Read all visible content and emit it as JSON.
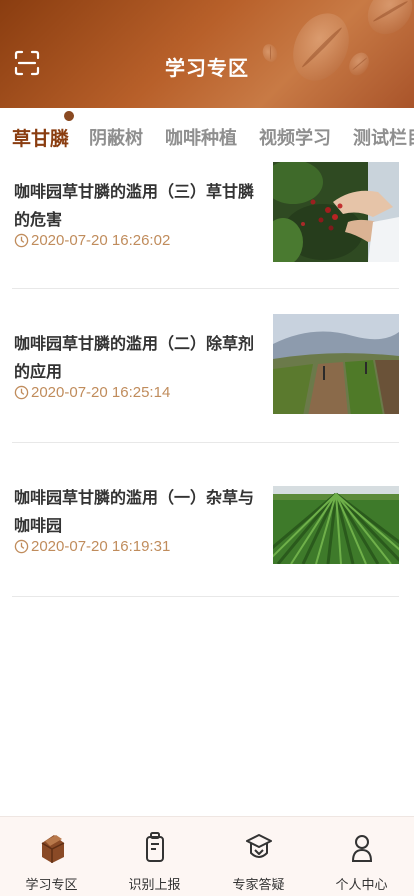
{
  "header": {
    "title": "学习专区"
  },
  "tabs": [
    {
      "label": "草甘膦",
      "active": true
    },
    {
      "label": "阴蔽树",
      "active": false
    },
    {
      "label": "咖啡种植",
      "active": false
    },
    {
      "label": "视频学习",
      "active": false
    },
    {
      "label": "测试栏目",
      "active": false
    }
  ],
  "articles": [
    {
      "title": "咖啡园草甘膦的滥用（三）草甘膦的危害",
      "time": "2020-07-20 16:26:02",
      "thumb": "coffee-picking-photo"
    },
    {
      "title": "咖啡园草甘膦的滥用（二）除草剂的应用",
      "time": "2020-07-20 16:25:14",
      "thumb": "hillside-plantation-photo"
    },
    {
      "title": "咖啡园草甘膦的滥用（一）杂草与咖啡园",
      "time": "2020-07-20 16:19:31",
      "thumb": "crop-rows-photo"
    }
  ],
  "bottom_nav": [
    {
      "label": "学习专区",
      "icon": "book-icon",
      "active": true
    },
    {
      "label": "识别上报",
      "icon": "report-icon",
      "active": false
    },
    {
      "label": "专家答疑",
      "icon": "expert-icon",
      "active": false
    },
    {
      "label": "个人中心",
      "icon": "user-icon",
      "active": false
    }
  ],
  "colors": {
    "brand": "#8a3d10",
    "time_text": "#c08c5c",
    "tab_inactive": "#8f8f8f"
  }
}
